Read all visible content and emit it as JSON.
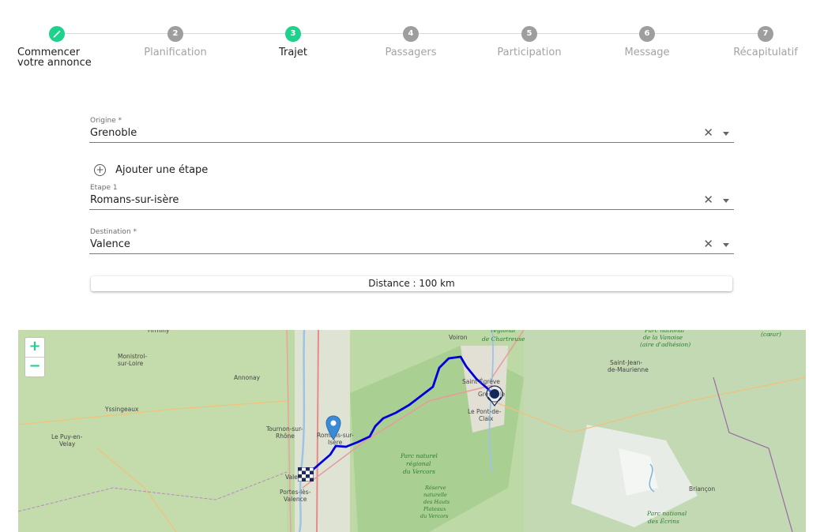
{
  "stepper": {
    "steps": [
      {
        "number": "",
        "label": "Commencer votre annonce",
        "label_line1": "Commencer",
        "label_line2": "votre annonce",
        "state": "done"
      },
      {
        "number": "2",
        "label": "Planification",
        "state": "pending"
      },
      {
        "number": "3",
        "label": "Trajet",
        "state": "active"
      },
      {
        "number": "4",
        "label": "Passagers",
        "state": "pending"
      },
      {
        "number": "5",
        "label": "Participation",
        "state": "pending"
      },
      {
        "number": "6",
        "label": "Message",
        "state": "pending"
      },
      {
        "number": "7",
        "label": "Récapitulatif",
        "state": "pending"
      }
    ]
  },
  "form": {
    "origin": {
      "label": "Origine *",
      "value": "Grenoble"
    },
    "add_step_label": "Ajouter une étape",
    "waypoint": {
      "label": "Etape 1",
      "value": "Romans-sur-isère"
    },
    "destination": {
      "label": "Destination *",
      "value": "Valence"
    },
    "distance": "Distance : 100 km"
  },
  "map": {
    "zoom_in": "+",
    "zoom_out": "−",
    "places": [
      "Firminy",
      "Monistrol-sur-Loire",
      "Annonay",
      "Yssingeaux",
      "Le Puy-en-Velay",
      "Tournon-sur-Rhône",
      "Romans-sur-Isère",
      "Valence",
      "Portes-lès-Valence",
      "Voiron",
      "Saint-Égrève",
      "Grenoble",
      "Le Pont-de-Claix",
      "Saint-Jean-de-Maurienne",
      "Briançon"
    ],
    "parks": [
      "Parc naturel régional du Vercors",
      "Réserve naturelle des Hauts Plateaux du Vercors",
      "Parc naturel régional de Chartreuse",
      "Parc national de la Vanoise (aire d'adhésion)",
      "Parc national des Écrins",
      "(cœur)"
    ],
    "route_color": "#0000dd",
    "accent": "#1dd28b"
  },
  "icons": {
    "done_step": "pencil-icon",
    "clear": "close-icon",
    "dropdown": "caret-down-icon",
    "add": "plus-circle-icon",
    "waypoint_marker": "map-pin-icon",
    "origin_marker": "start-marker-icon",
    "destination_marker": "checkered-flag-icon"
  }
}
